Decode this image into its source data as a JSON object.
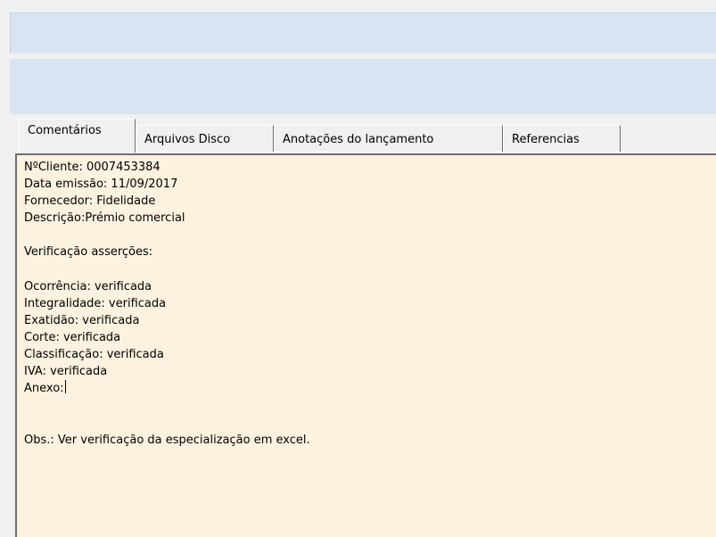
{
  "tabs": [
    {
      "label": "Comentários",
      "active": true
    },
    {
      "label": "Arquivos Disco",
      "active": false
    },
    {
      "label": "Anotações do lançamento",
      "active": false
    },
    {
      "label": "Referencias",
      "active": false
    }
  ],
  "comments": {
    "lines": [
      "NºCliente: 0007453384",
      "Data emissão: 11/09/2017",
      "Fornecedor: Fidelidade",
      "Descrição:Prémio comercial",
      "",
      "Verificação asserções:",
      "",
      "Ocorrência: verificada",
      "Integralidade: verificada",
      "Exatidão: verificada",
      "Corte: verificada",
      "Classificação: verificada",
      "IVA: verificada",
      "Anexo:",
      "",
      "",
      "Obs.: Ver verificação da especialização em excel."
    ]
  },
  "colors": {
    "toolbar_background": "#d7e4f2",
    "editor_background": "#fdf2df",
    "window_background": "#f0f0f0"
  }
}
